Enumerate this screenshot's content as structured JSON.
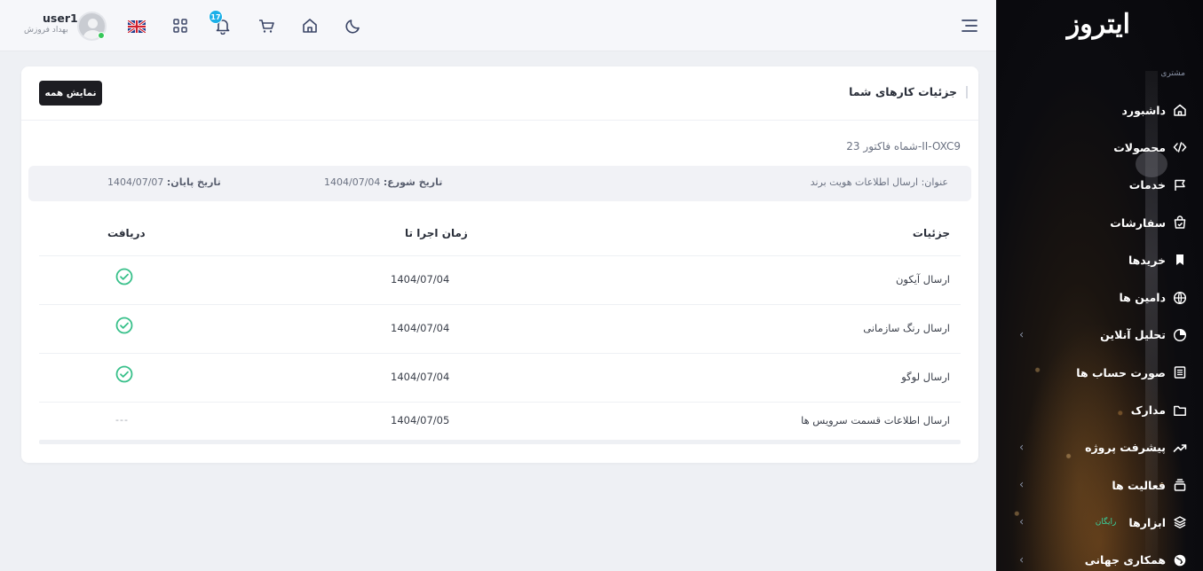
{
  "sidebar": {
    "logo": "ایتروز",
    "section_label": "مشتری",
    "items": [
      {
        "label": "داشبورد",
        "icon": "home-icon",
        "chevron": false
      },
      {
        "label": "محصولات",
        "icon": "code-icon",
        "chevron": false
      },
      {
        "label": "خدمات",
        "icon": "flag-icon",
        "chevron": false
      },
      {
        "label": "سفارشات",
        "icon": "shopping-bag-icon",
        "chevron": false
      },
      {
        "label": "خریدها",
        "icon": "bookmark-icon",
        "chevron": false
      },
      {
        "label": "دامین ها",
        "icon": "globe-icon",
        "chevron": false
      },
      {
        "label": "تحلیل آنلاین",
        "icon": "pie-chart-icon",
        "chevron": true
      },
      {
        "label": "صورت حساب ها",
        "icon": "invoice-icon",
        "chevron": false
      },
      {
        "label": "مدارک",
        "icon": "folder-icon",
        "chevron": false
      },
      {
        "label": "پیشرفت پروژه",
        "icon": "trending-up-icon",
        "chevron": true
      },
      {
        "label": "فعالیت ها",
        "icon": "layers-box-icon",
        "chevron": true
      },
      {
        "label": "ابزارها",
        "icon": "stack-icon",
        "chevron": true,
        "badge": "رایگان"
      },
      {
        "label": "همکاری جهانی",
        "icon": "world-icon",
        "chevron": true
      }
    ]
  },
  "header": {
    "notification_count": "17",
    "username": "user1",
    "user_fullname": "بهداد فروزش",
    "icons": [
      "menu-icon",
      "moon-icon",
      "home-icon",
      "cart-icon",
      "bell-icon",
      "grid-icon",
      "uk-flag-icon",
      "avatar"
    ]
  },
  "card": {
    "title": "جزئیات کارهای شما",
    "show_all": "نمایش همه",
    "invoice": "شماه فاکتور 23-II-OXC9",
    "subject_label": "عنوان:",
    "subject_value": "ارسال اطلاعات هویت برند",
    "start_label": "تاریخ شورع:",
    "start_value": "1404/07/04",
    "end_label": "تاریخ پایان:",
    "end_value": "1404/07/07"
  },
  "table": {
    "headers": {
      "details": "جزئیات",
      "run_time": "زمان اجرا تا",
      "received": "دریافت"
    },
    "rows": [
      {
        "details": "ارسال آیکون",
        "date": "1404/07/04",
        "received": true
      },
      {
        "details": "ارسال رنگ سازمانی",
        "date": "1404/07/04",
        "received": true
      },
      {
        "details": "ارسال لوگو",
        "date": "1404/07/04",
        "received": true
      },
      {
        "details": "ارسال اطلاعات قسمت سرویس ها",
        "date": "1404/07/05",
        "received": false,
        "placeholder": "---"
      }
    ]
  },
  "colors": {
    "accent_green": "#38c08a",
    "badge_blue": "#1cb0e8",
    "button_dark": "#1d1d22"
  }
}
